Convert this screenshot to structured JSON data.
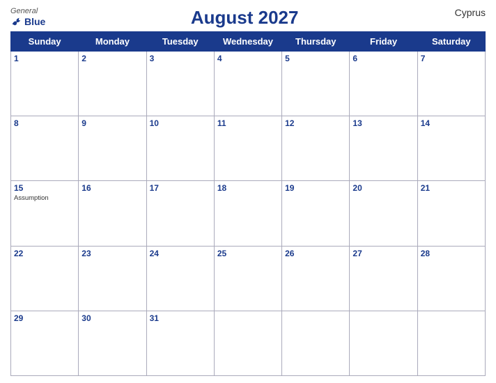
{
  "header": {
    "logo_general": "General",
    "logo_blue": "Blue",
    "title": "August 2027",
    "country": "Cyprus"
  },
  "weekdays": [
    "Sunday",
    "Monday",
    "Tuesday",
    "Wednesday",
    "Thursday",
    "Friday",
    "Saturday"
  ],
  "weeks": [
    [
      {
        "date": "1",
        "holiday": ""
      },
      {
        "date": "2",
        "holiday": ""
      },
      {
        "date": "3",
        "holiday": ""
      },
      {
        "date": "4",
        "holiday": ""
      },
      {
        "date": "5",
        "holiday": ""
      },
      {
        "date": "6",
        "holiday": ""
      },
      {
        "date": "7",
        "holiday": ""
      }
    ],
    [
      {
        "date": "8",
        "holiday": ""
      },
      {
        "date": "9",
        "holiday": ""
      },
      {
        "date": "10",
        "holiday": ""
      },
      {
        "date": "11",
        "holiday": ""
      },
      {
        "date": "12",
        "holiday": ""
      },
      {
        "date": "13",
        "holiday": ""
      },
      {
        "date": "14",
        "holiday": ""
      }
    ],
    [
      {
        "date": "15",
        "holiday": "Assumption"
      },
      {
        "date": "16",
        "holiday": ""
      },
      {
        "date": "17",
        "holiday": ""
      },
      {
        "date": "18",
        "holiday": ""
      },
      {
        "date": "19",
        "holiday": ""
      },
      {
        "date": "20",
        "holiday": ""
      },
      {
        "date": "21",
        "holiday": ""
      }
    ],
    [
      {
        "date": "22",
        "holiday": ""
      },
      {
        "date": "23",
        "holiday": ""
      },
      {
        "date": "24",
        "holiday": ""
      },
      {
        "date": "25",
        "holiday": ""
      },
      {
        "date": "26",
        "holiday": ""
      },
      {
        "date": "27",
        "holiday": ""
      },
      {
        "date": "28",
        "holiday": ""
      }
    ],
    [
      {
        "date": "29",
        "holiday": ""
      },
      {
        "date": "30",
        "holiday": ""
      },
      {
        "date": "31",
        "holiday": ""
      },
      {
        "date": "",
        "holiday": ""
      },
      {
        "date": "",
        "holiday": ""
      },
      {
        "date": "",
        "holiday": ""
      },
      {
        "date": "",
        "holiday": ""
      }
    ]
  ]
}
